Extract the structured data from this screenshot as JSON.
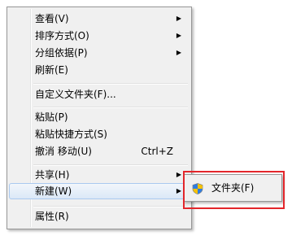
{
  "context_menu": {
    "items": [
      {
        "label": "查看(V)",
        "has_submenu": true
      },
      {
        "label": "排序方式(O)",
        "has_submenu": true
      },
      {
        "label": "分组依据(P)",
        "has_submenu": true
      },
      {
        "label": "刷新(E)",
        "has_submenu": false
      },
      {
        "label": "自定义文件夹(F)...",
        "has_submenu": false
      },
      {
        "label": "粘贴(P)",
        "has_submenu": false
      },
      {
        "label": "粘贴快捷方式(S)",
        "has_submenu": false
      },
      {
        "label": "撤消 移动(U)",
        "shortcut": "Ctrl+Z",
        "has_submenu": false
      },
      {
        "label": "共享(H)",
        "has_submenu": true
      },
      {
        "label": "新建(W)",
        "has_submenu": true,
        "state": "hover"
      },
      {
        "label": "属性(R)",
        "has_submenu": false
      }
    ],
    "arrow_glyph": "▶"
  },
  "submenu": {
    "items": [
      {
        "label": "文件夹(F)",
        "icon": "shield-icon"
      }
    ]
  },
  "colors": {
    "highlight_box": "#e3262b",
    "hover_background": "#dbe8f7",
    "menu_background": "#f0f0f0"
  }
}
